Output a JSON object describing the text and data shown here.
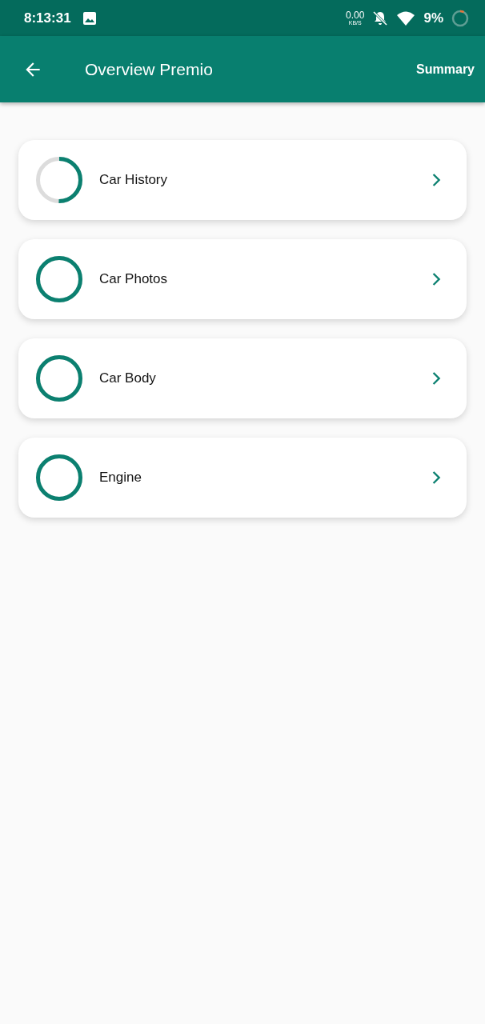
{
  "status_bar": {
    "time": "8:13:31",
    "net_speed": "0.00",
    "net_unit": "KB/S",
    "battery": "9%"
  },
  "app_bar": {
    "title": "Overview Premio",
    "action": "Summary"
  },
  "sections": [
    {
      "label": "Car History",
      "level": 0.5
    },
    {
      "label": "Car Photos",
      "level": 1
    },
    {
      "label": "Car Body",
      "level": 1
    },
    {
      "label": "Engine",
      "level": 1
    }
  ]
}
